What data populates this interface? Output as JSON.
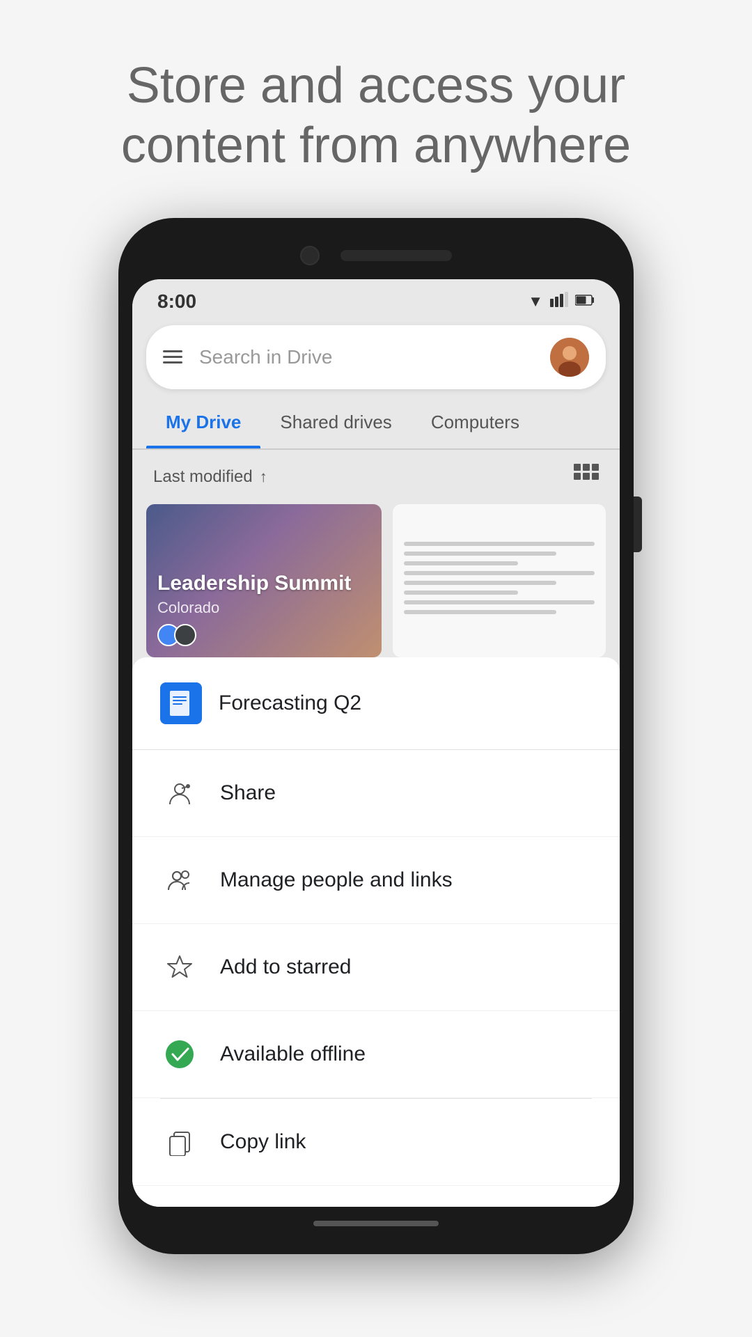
{
  "hero": {
    "text": "Store and access your content from anywhere"
  },
  "status_bar": {
    "time": "8:00",
    "wifi": "▼",
    "signal": "▲",
    "battery": "🔋"
  },
  "search": {
    "placeholder": "Search in Drive"
  },
  "tabs": [
    {
      "id": "my-drive",
      "label": "My Drive",
      "active": true
    },
    {
      "id": "shared-drives",
      "label": "Shared drives",
      "active": false
    },
    {
      "id": "computers",
      "label": "Computers",
      "active": false
    }
  ],
  "sort": {
    "label": "Last modified",
    "direction": "↑"
  },
  "files": [
    {
      "id": "leadership",
      "title": "Leadership Summit",
      "subtitle": "Colorado",
      "type": "presentation"
    },
    {
      "id": "document",
      "type": "document"
    }
  ],
  "bottom_sheet": {
    "file_name": "Forecasting Q2",
    "menu_items": [
      {
        "id": "share",
        "label": "Share",
        "icon": "person-add"
      },
      {
        "id": "manage-people",
        "label": "Manage people and links",
        "icon": "people"
      },
      {
        "id": "add-starred",
        "label": "Add to starred",
        "icon": "star"
      },
      {
        "id": "available-offline",
        "label": "Available offline",
        "icon": "check-circle"
      },
      {
        "id": "copy-link",
        "label": "Copy link",
        "icon": "copy"
      }
    ]
  }
}
